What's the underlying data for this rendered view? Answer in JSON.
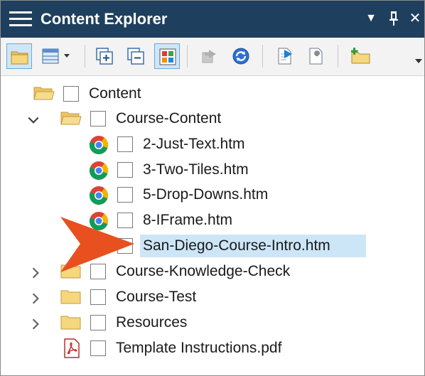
{
  "window": {
    "title": "Content Explorer",
    "dropdown_glyph": "▼",
    "pin_glyph": "📌",
    "close_glyph": "✕"
  },
  "toolbar": {
    "items": [
      {
        "icon": "open-folder-icon",
        "active": true
      },
      {
        "icon": "grid-view-icon",
        "active": false
      },
      {
        "icon": "expand-all-icon",
        "active": false
      },
      {
        "icon": "collapse-all-icon",
        "active": false
      },
      {
        "icon": "color-tiles-icon",
        "active": true
      },
      {
        "icon": "move-disabled-icon",
        "active": false
      },
      {
        "icon": "refresh-icon",
        "active": false
      },
      {
        "icon": "new-file-icon",
        "active": false
      },
      {
        "icon": "file-properties-icon",
        "active": false
      },
      {
        "icon": "new-folder-icon",
        "active": false
      }
    ]
  },
  "tree": {
    "items": [
      {
        "label": "Content",
        "type": "folder-open",
        "level": 0,
        "expander": ""
      },
      {
        "label": "Course-Content",
        "type": "folder-open",
        "level": 1,
        "expander": "expanded"
      },
      {
        "label": "2-Just-Text.htm",
        "type": "chrome",
        "level": 2,
        "expander": ""
      },
      {
        "label": "3-Two-Tiles.htm",
        "type": "chrome",
        "level": 2,
        "expander": ""
      },
      {
        "label": "5-Drop-Downs.htm",
        "type": "chrome",
        "level": 2,
        "expander": ""
      },
      {
        "label": "8-IFrame.htm",
        "type": "chrome",
        "level": 2,
        "expander": ""
      },
      {
        "label": "San-Diego-Course-Intro.htm",
        "type": "chrome",
        "level": 2,
        "expander": "",
        "selected": true
      },
      {
        "label": "Course-Knowledge-Check",
        "type": "folder",
        "level": 1,
        "expander": "collapsed"
      },
      {
        "label": "Course-Test",
        "type": "folder",
        "level": 1,
        "expander": "collapsed"
      },
      {
        "label": "Resources",
        "type": "folder",
        "level": 1,
        "expander": "collapsed"
      },
      {
        "label": "Template Instructions.pdf",
        "type": "pdf",
        "level": 1,
        "expander": ""
      }
    ]
  },
  "colors": {
    "titlebar": "#1f3f5e",
    "selection": "#cde6f7",
    "callout": "#e8501f"
  }
}
